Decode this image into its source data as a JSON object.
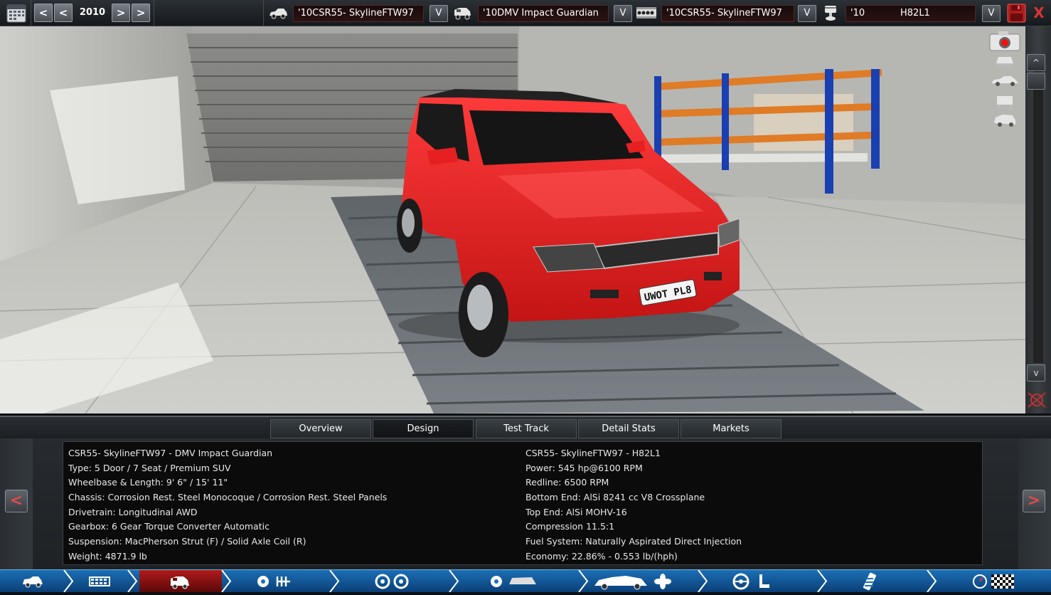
{
  "topbar": {
    "year": "2010",
    "prev_label": "<",
    "prev_fast_label": "<",
    "next_label": ">",
    "next_fast_label": ">",
    "model_select": "'10CSR55- SkylineFTW97",
    "trim_select": "'10DMV Impact Guardian",
    "engine_family_select": "'10CSR55- SkylineFTW97",
    "engine_select_year": "'10",
    "engine_select_name": "H82L1",
    "dropdown_label": "V",
    "close_label": "X"
  },
  "viewport": {
    "plate": "UWOT PL8",
    "scroll_up": "^",
    "scroll_down": "v"
  },
  "tabs": [
    {
      "label": "Overview",
      "active": false
    },
    {
      "label": "Design",
      "active": true
    },
    {
      "label": "Test Track",
      "active": false
    },
    {
      "label": "Detail Stats",
      "active": false
    },
    {
      "label": "Markets",
      "active": false
    }
  ],
  "info": {
    "left": [
      "CSR55- SkylineFTW97 - DMV Impact Guardian",
      "Type: 5 Door / 7 Seat / Premium SUV",
      "Wheelbase & Length: 9' 6\" / 15' 11\"",
      "Chassis: Corrosion Rest. Steel Monocoque / Corrosion Rest. Steel Panels",
      "Drivetrain: Longitudinal AWD",
      "Gearbox: 6 Gear Torque Converter Automatic",
      "Suspension: MacPherson Strut (F) / Solid Axle Coil (R)",
      "Weight: 4871.9 lb"
    ],
    "right": [
      "CSR55- SkylineFTW97 - H82L1",
      "Power: 545 hp@6100 RPM",
      "Redline: 6500 RPM",
      "Bottom End: AlSi 8241 cc V8 Crossplane",
      "Top End: AlSi MOHV-16",
      "Compression 11.5:1",
      "Fuel System: Naturally Aspirated Direct Injection",
      "Economy: 22.86% - 0.553 lb/(hph)"
    ],
    "prev_arrow": "<",
    "next_arrow": ">"
  },
  "colors": {
    "car_body": "#e41f1f",
    "accent_red": "#c0201f",
    "bottom_blue": "#1b6fb5"
  },
  "icons": {
    "calendar": "calendar-icon",
    "car_model": "car-icon",
    "car_trim": "car-trim-icon",
    "engine_family": "engine-block-icon",
    "engine": "engine-piston-icon",
    "save": "save-icon",
    "close": "close-icon",
    "camera": "camera-icon"
  }
}
